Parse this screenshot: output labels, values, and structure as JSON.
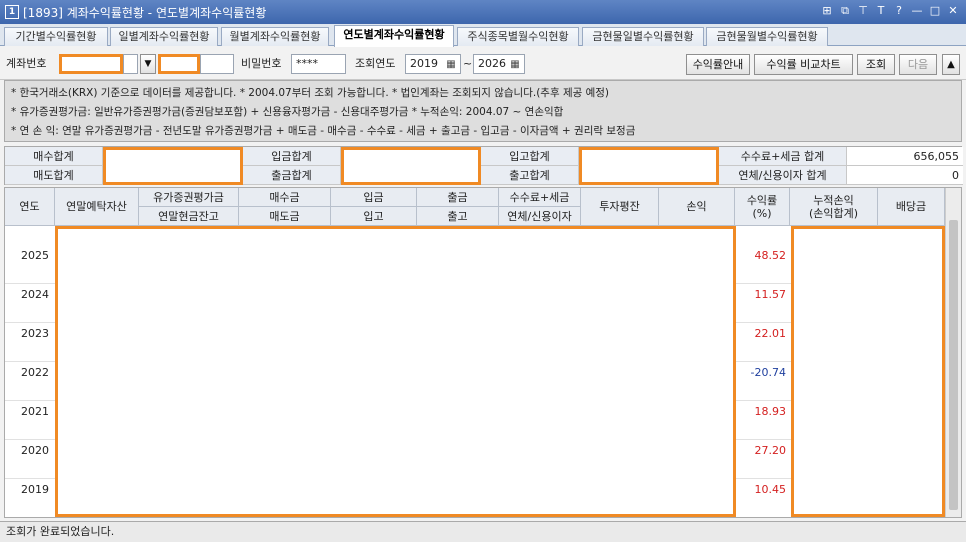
{
  "window": {
    "icon": "1",
    "title": "[1893] 계좌수익률현황 - 연도별계좌수익률현황",
    "controls": [
      "⊞",
      "⧉",
      "⊤",
      "T",
      "?",
      "—",
      "□",
      "✕"
    ]
  },
  "tabs": [
    {
      "label": "기간별수익률현황"
    },
    {
      "label": "일별계좌수익률현황"
    },
    {
      "label": "월별계좌수익률현황"
    },
    {
      "label": "연도별계좌수익률현황",
      "active": true
    },
    {
      "label": "주식종목별월수익현황"
    },
    {
      "label": "금현물일별수익률현황"
    },
    {
      "label": "금현물월별수익률현황"
    }
  ],
  "query": {
    "account_label": "계좌번호",
    "account_value": "",
    "account_name": "",
    "password_label": "비밀번호",
    "password_value": "****",
    "year_label": "조회연도",
    "year_from": "2019",
    "range_sep": "~",
    "year_to": "2026",
    "btn_guide": "수익률안내",
    "btn_compare": "수익률 비교차트",
    "btn_query": "조회",
    "btn_next": "다음",
    "btn_collapse": "▲"
  },
  "notice": {
    "line1": "* 한국거래소(KRX) 기준으로 데이터를 제공합니다.  * 2004.07부터 조회 가능합니다.  * 법인계좌는 조회되지 않습니다.(추후 제공 예정)",
    "line2": "* 유가증권평가금: 일반유가증권평가금(증권담보포함) + 신용융자평가금 - 신용대주평가금   * 누적손익: 2004.07 ~ 연손익합",
    "line3": "* 연 손 익: 연말 유가증권평가금 - 전년도말 유가증권평가금 + 매도금 - 매수금 - 수수료 - 세금 + 출고금 - 입고금 - 이자금액 + 권리락 보정금"
  },
  "summary": {
    "buy_total_label": "매수합계",
    "sell_total_label": "매도합계",
    "deposit_total_label": "입금합계",
    "withdraw_total_label": "출금합계",
    "in_total_label": "입고합계",
    "out_total_label": "출고합계",
    "fee_tax_label": "수수료+세금 합계",
    "fee_tax_value": "656,055",
    "overdue_label": "연체/신용이자 합계",
    "overdue_value": "0"
  },
  "grid": {
    "headers": {
      "year": "연도",
      "deposit_asset": "연말예탁자산",
      "securities_eval": "유가증권평가금",
      "cash_balance": "연말현금잔고",
      "buy_amount": "매수금",
      "sell_amount": "매도금",
      "deposit": "입금",
      "inbound": "입고",
      "withdraw": "출금",
      "outbound": "출고",
      "fee_tax": "수수료+세금",
      "overdue_interest": "연체/신용이자",
      "avg_investment": "투자평잔",
      "profit": "손익",
      "return_rate": "수익률\n(%)",
      "cumulative": "누적손익\n(손익합계)",
      "dividend": "배당금"
    },
    "rows": [
      {
        "year": "2025",
        "rate": "48.52",
        "sign": "pos"
      },
      {
        "year": "2024",
        "rate": "11.57",
        "sign": "pos"
      },
      {
        "year": "2023",
        "rate": "22.01",
        "sign": "pos"
      },
      {
        "year": "2022",
        "rate": "-20.74",
        "sign": "neg"
      },
      {
        "year": "2021",
        "rate": "18.93",
        "sign": "pos"
      },
      {
        "year": "2020",
        "rate": "27.20",
        "sign": "pos"
      },
      {
        "year": "2019",
        "rate": "10.45",
        "sign": "pos"
      }
    ]
  },
  "status": {
    "message": "조회가 완료되었습니다."
  },
  "colors": {
    "highlight": "#f08a24",
    "positive": "#d42020",
    "negative": "#1f3f9e"
  }
}
